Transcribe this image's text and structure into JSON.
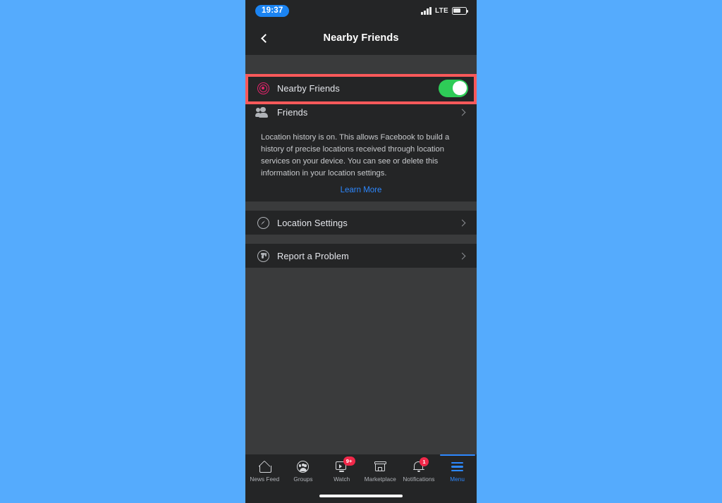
{
  "status_bar": {
    "time": "19:37",
    "network": "LTE",
    "signal_icon": "signal-bars-icon",
    "battery_icon": "battery-icon",
    "battery_level_pct": 60
  },
  "header": {
    "back_icon": "chevron-left-icon",
    "title": "Nearby Friends"
  },
  "settings": {
    "nearby_friends_row": {
      "icon": "radar-location-icon",
      "label": "Nearby Friends",
      "toggle_state": "on",
      "toggle_on_color": "#2ecc57",
      "highlighted": true,
      "highlight_color": "#f9595a"
    },
    "friends_row": {
      "icon": "friends-people-icon",
      "label": "Friends",
      "chevron_icon": "chevron-right-icon"
    },
    "location_history_info": {
      "text": "Location history is on. This allows Facebook to build a history of precise locations received through location services on your device. You can see or delete this information in your location settings.",
      "link_label": "Learn More",
      "link_color": "#2d88ff"
    },
    "location_settings_row": {
      "icon": "compass-icon",
      "label": "Location Settings",
      "chevron_icon": "chevron-right-icon"
    },
    "report_problem_row": {
      "icon": "report-thumbs-down-icon",
      "label": "Report a Problem",
      "chevron_icon": "chevron-right-icon"
    }
  },
  "tab_bar": {
    "active_tab": "Menu",
    "active_color": "#2d88ff",
    "badge_color": "#f02849",
    "tabs": [
      {
        "label": "News Feed",
        "icon": "home-icon",
        "badge": ""
      },
      {
        "label": "Groups",
        "icon": "groups-icon",
        "badge": ""
      },
      {
        "label": "Watch",
        "icon": "watch-video-icon",
        "badge": "9+"
      },
      {
        "label": "Marketplace",
        "icon": "marketplace-storefront-icon",
        "badge": ""
      },
      {
        "label": "Notifications",
        "icon": "bell-icon",
        "badge": "1"
      },
      {
        "label": "Menu",
        "icon": "hamburger-menu-icon",
        "badge": ""
      }
    ]
  },
  "theme": {
    "page_background": "#55abfd",
    "app_background": "#3a3b3c",
    "surface": "#242526"
  }
}
